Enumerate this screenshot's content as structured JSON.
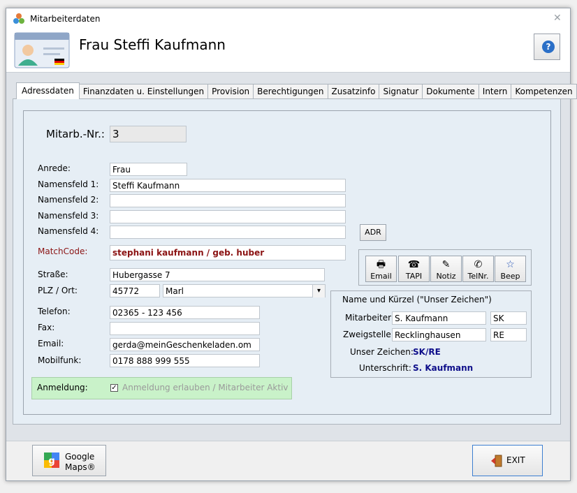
{
  "window": {
    "title": "Mitarbeiterdaten",
    "close_glyph": "✕"
  },
  "header": {
    "name": "Frau Steffi Kaufmann",
    "help_glyph": "?"
  },
  "tabs": [
    "Adressdaten",
    "Finanzdaten u. Einstellungen",
    "Provision",
    "Berechtigungen",
    "Zusatzinfo",
    "Signatur",
    "Dokumente",
    "Intern",
    "Kompetenzen"
  ],
  "form": {
    "mitarb_nr_label": "Mitarb.-Nr.:",
    "mitarb_nr": "3",
    "anrede_label": "Anrede:",
    "anrede": "Frau",
    "namensfeld1_label": "Namensfeld 1:",
    "namensfeld1": "Steffi Kaufmann",
    "namensfeld2_label": "Namensfeld 2:",
    "namensfeld2": "",
    "namensfeld3_label": "Namensfeld 3:",
    "namensfeld3": "",
    "namensfeld4_label": "Namensfeld 4:",
    "namensfeld4": "",
    "matchcode_label": "MatchCode:",
    "matchcode": "stephani kaufmann / geb. huber",
    "strasse_label": "Straße:",
    "strasse": "Hubergasse 7",
    "plz_ort_label": "PLZ / Ort:",
    "plz": "45772",
    "ort": "Marl",
    "telefon_label": "Telefon:",
    "telefon": "02365 - 123 456",
    "fax_label": "Fax:",
    "fax": "",
    "email_label": "Email:",
    "email": "gerda@meinGeschenkeladen.om",
    "mobilfunk_label": "Mobilfunk:",
    "mobilfunk": "0178 888 999 555"
  },
  "adr_button": "ADR",
  "action_buttons": [
    {
      "label": "Email",
      "icon": "printer-icon",
      "glyph": "🖶"
    },
    {
      "label": "TAPI",
      "icon": "phone-icon",
      "glyph": "☎"
    },
    {
      "label": "Notiz",
      "icon": "note-icon",
      "glyph": "✎"
    },
    {
      "label": "TelNr.",
      "icon": "dial-icon",
      "glyph": "✆"
    },
    {
      "label": "Beep",
      "icon": "star-icon",
      "glyph": "☆"
    }
  ],
  "kuerzel": {
    "title": "Name und Kürzel (\"Unser Zeichen\")",
    "mitarbeiter_label": "Mitarbeiter:",
    "mitarbeiter": "S. Kaufmann",
    "mitarbeiter_kurz": "SK",
    "zweigstelle_label": "Zweigstelle:",
    "zweigstelle": "Recklinghausen",
    "zweigstelle_kurz": "RE",
    "unser_zeichen_label": "Unser Zeichen:",
    "unser_zeichen": "SK/RE",
    "unterschrift_label": "Unterschrift:",
    "unterschrift": "S. Kaufmann"
  },
  "anmeldung": {
    "label": "Anmeldung:",
    "checkbox_text": "Anmeldung erlauben / Mitarbeiter Aktiv",
    "checked": true
  },
  "footer": {
    "gmaps_line1": "Google",
    "gmaps_line2": "Maps®",
    "exit_label": "EXIT"
  },
  "colors": {
    "matchcode": "#8b1313",
    "blue_value": "#0e0e8a",
    "anmeldung_bg": "#c9f2c9",
    "help_blue": "#2b6fc7"
  }
}
